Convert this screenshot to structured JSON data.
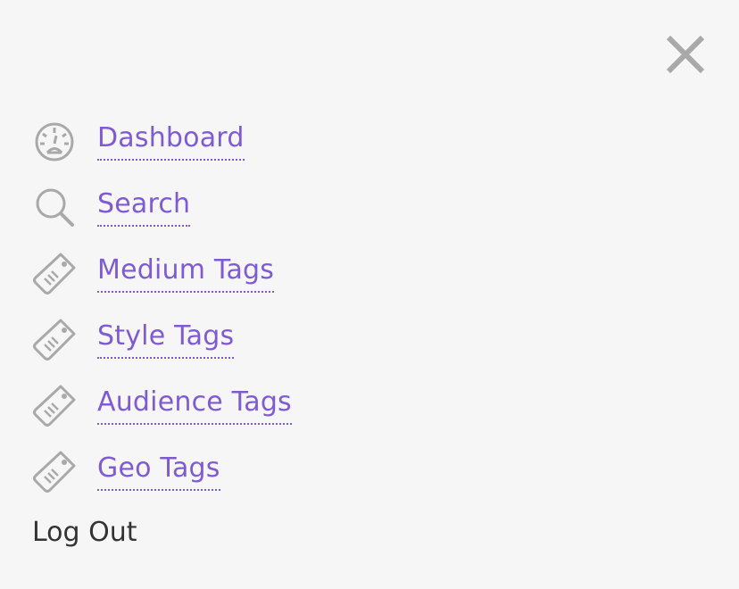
{
  "colors": {
    "background": "#f6f6f6",
    "link": "#7f5bd3",
    "icon": "#a9a9a9",
    "text": "#333333"
  },
  "header": {
    "close_icon": "close-icon"
  },
  "nav": {
    "items": [
      {
        "label": "Dashboard",
        "icon": "dashboard-gauge-icon"
      },
      {
        "label": "Search",
        "icon": "search-icon"
      },
      {
        "label": "Medium Tags",
        "icon": "tag-icon"
      },
      {
        "label": "Style Tags",
        "icon": "tag-icon"
      },
      {
        "label": "Audience Tags",
        "icon": "tag-icon"
      },
      {
        "label": "Geo Tags",
        "icon": "tag-icon"
      }
    ]
  },
  "footer": {
    "logout_label": "Log Out"
  }
}
